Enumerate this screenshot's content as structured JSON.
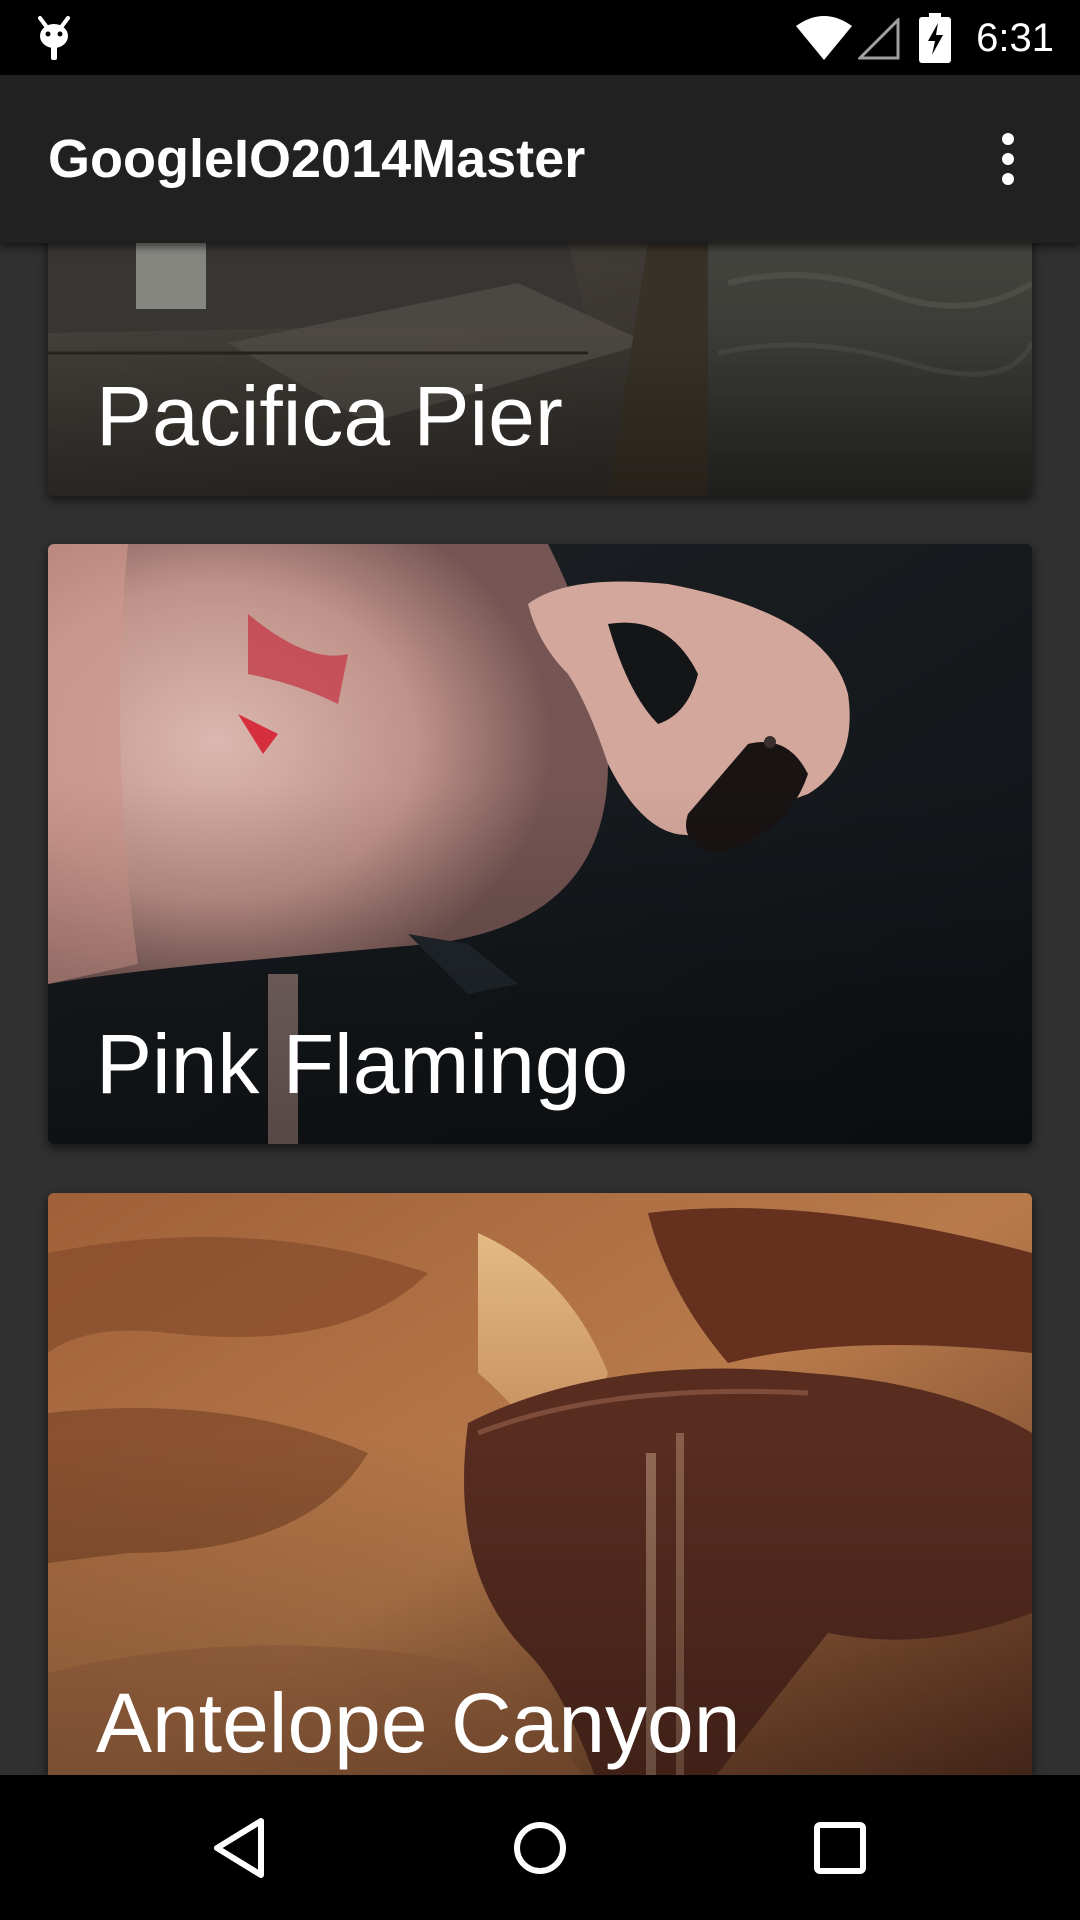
{
  "status_bar": {
    "time": "6:31",
    "icons": [
      "debug-icon",
      "wifi-icon",
      "signal-icon",
      "battery-charging-icon"
    ]
  },
  "app_bar": {
    "title": "GoogleIO2014Master",
    "overflow_icon": "more-vert-icon"
  },
  "cards": [
    {
      "label": "Pacifica Pier"
    },
    {
      "label": "Pink Flamingo"
    },
    {
      "label": "Antelope Canyon"
    }
  ],
  "nav_bar": {
    "icons": [
      "back-icon",
      "home-icon",
      "recents-icon"
    ]
  },
  "colors": {
    "status_bar": "#000000",
    "app_bar": "#212121",
    "background": "#303030",
    "nav_bar": "#000000",
    "text": "#ffffff"
  }
}
